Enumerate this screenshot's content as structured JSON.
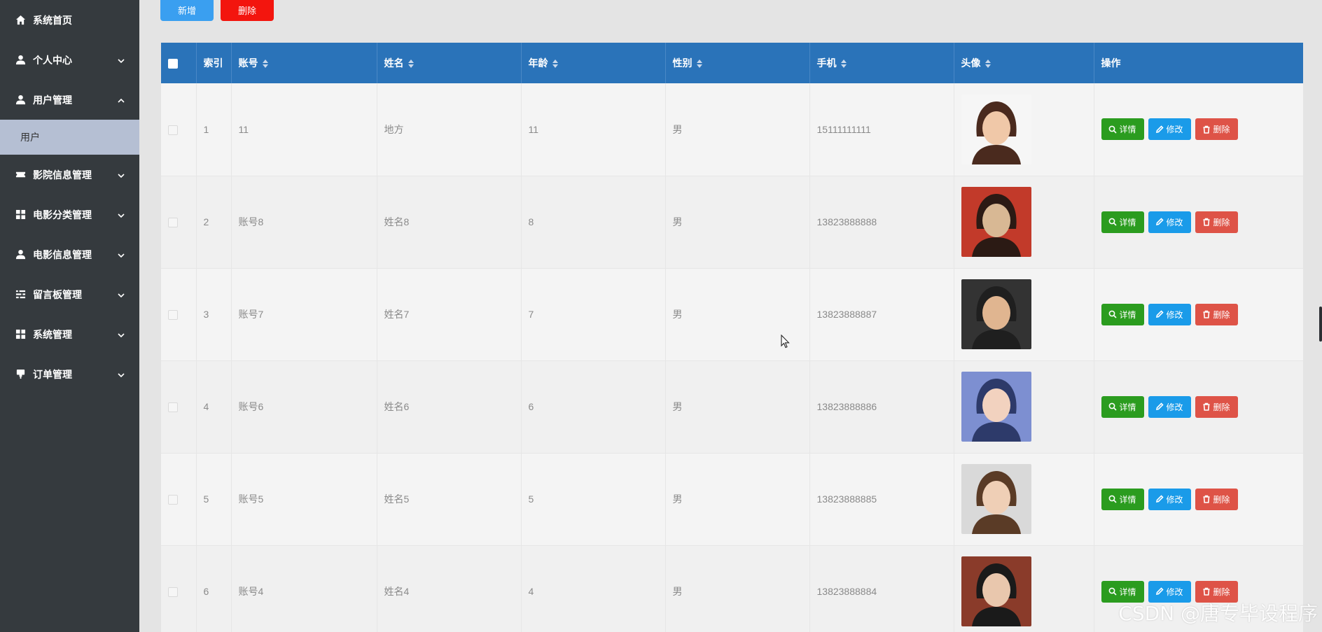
{
  "sidebar": {
    "items": [
      {
        "label": "系统首页",
        "icon": "home-icon",
        "expandable": false
      },
      {
        "label": "个人中心",
        "icon": "person-icon",
        "expandable": true
      },
      {
        "label": "用户管理",
        "icon": "person-icon",
        "expandable": true,
        "expanded": true,
        "children": [
          "用户"
        ]
      },
      {
        "label": "影院信息管理",
        "icon": "ticket-icon",
        "expandable": true
      },
      {
        "label": "电影分类管理",
        "icon": "grid-icon",
        "expandable": true
      },
      {
        "label": "电影信息管理",
        "icon": "person-icon",
        "expandable": true
      },
      {
        "label": "留言板管理",
        "icon": "list-icon",
        "expandable": true
      },
      {
        "label": "系统管理",
        "icon": "grid-icon",
        "expandable": true
      },
      {
        "label": "订单管理",
        "icon": "pin-icon",
        "expandable": true
      }
    ]
  },
  "toolbar": {
    "add_label": "新增",
    "delete_label": "删除"
  },
  "table": {
    "headers": [
      "索引",
      "账号",
      "姓名",
      "年龄",
      "性别",
      "手机",
      "头像",
      "操作"
    ],
    "rows": [
      {
        "index": "1",
        "account": "11",
        "name": "地方",
        "age": "11",
        "gender": "男",
        "phone": "15111111111"
      },
      {
        "index": "2",
        "account": "账号8",
        "name": "姓名8",
        "age": "8",
        "gender": "男",
        "phone": "13823888888"
      },
      {
        "index": "3",
        "account": "账号7",
        "name": "姓名7",
        "age": "7",
        "gender": "男",
        "phone": "13823888887"
      },
      {
        "index": "4",
        "account": "账号6",
        "name": "姓名6",
        "age": "6",
        "gender": "男",
        "phone": "13823888886"
      },
      {
        "index": "5",
        "account": "账号5",
        "name": "姓名5",
        "age": "5",
        "gender": "男",
        "phone": "13823888885"
      },
      {
        "index": "6",
        "account": "账号4",
        "name": "姓名4",
        "age": "4",
        "gender": "男",
        "phone": "13823888884"
      }
    ],
    "actions": {
      "detail": "详情",
      "edit": "修改",
      "delete": "删除"
    }
  },
  "watermark": "CSDN @唐专毕设程序",
  "colors": {
    "sidebar_bg": "#353a3e",
    "header_bg": "#2a73b9",
    "detail_btn": "#2b9c1f",
    "edit_btn": "#1a9be9",
    "delete_btn": "#de5347",
    "add_btn": "#3a9ff0",
    "top_delete_btn": "#f3150e"
  }
}
